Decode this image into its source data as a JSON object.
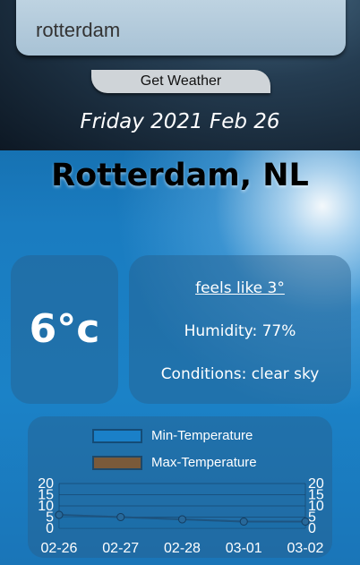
{
  "search": {
    "value": "rotterdam"
  },
  "button": {
    "label": "Get Weather"
  },
  "date": "Friday 2021 Feb 26",
  "location": "Rotterdam, NL",
  "current": {
    "temperature": "6°c",
    "feels_like": "feels like 3°",
    "humidity": "Humidity: 77%",
    "conditions": "Conditions: clear sky"
  },
  "legend": {
    "min_label": "Min-Temperature",
    "max_label": "Max-Temperature",
    "min_color": "#1a80c8",
    "max_color": "#7a5a3a"
  },
  "chart_data": {
    "type": "line",
    "categories": [
      "02-26",
      "02-27",
      "02-28",
      "03-01",
      "03-02"
    ],
    "series": [
      {
        "name": "Min-Temperature",
        "values": [
          6,
          5,
          4,
          3,
          3
        ]
      },
      {
        "name": "Max-Temperature",
        "values": [
          6,
          5,
          4,
          3,
          3
        ]
      }
    ],
    "ylim": [
      0,
      20
    ],
    "yticks": [
      0,
      5,
      10,
      15,
      20
    ],
    "legend_position": "top"
  }
}
